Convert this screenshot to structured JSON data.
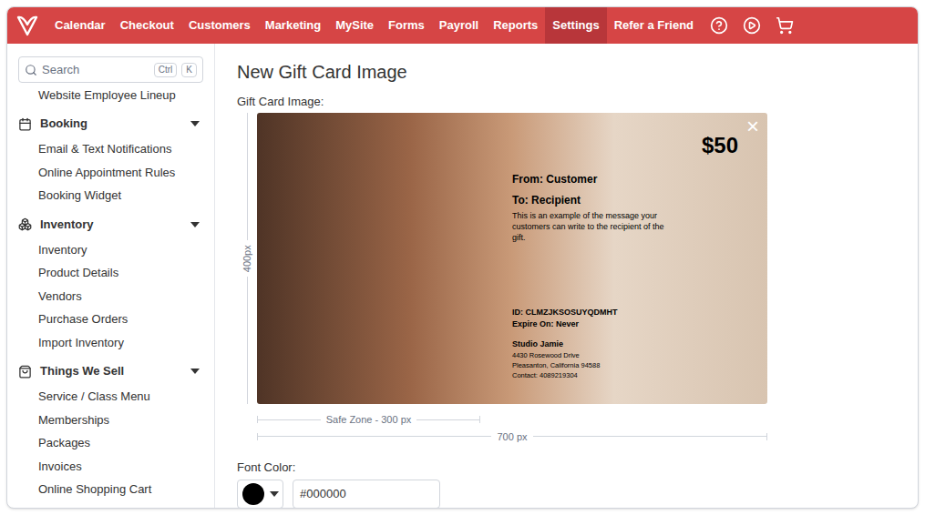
{
  "nav": {
    "items": [
      {
        "label": "Calendar",
        "selected": false
      },
      {
        "label": "Checkout",
        "selected": false
      },
      {
        "label": "Customers",
        "selected": false
      },
      {
        "label": "Marketing",
        "selected": false
      },
      {
        "label": "MySite",
        "selected": false
      },
      {
        "label": "Forms",
        "selected": false
      },
      {
        "label": "Payroll",
        "selected": false
      },
      {
        "label": "Reports",
        "selected": false
      },
      {
        "label": "Settings",
        "selected": true
      },
      {
        "label": "Refer a Friend",
        "selected": false
      }
    ]
  },
  "search": {
    "placeholder": "Search",
    "shortcut": [
      "Ctrl",
      "K"
    ]
  },
  "sidebar": {
    "items": [
      "Website Employee Lineup"
    ],
    "sections": [
      {
        "title": "Booking",
        "icon": "calendar",
        "expanded": true,
        "items": [
          "Email & Text Notifications",
          "Online Appointment Rules",
          "Booking Widget"
        ]
      },
      {
        "title": "Inventory",
        "icon": "boxes",
        "expanded": true,
        "items": [
          "Inventory",
          "Product Details",
          "Vendors",
          "Purchase Orders",
          "Import Inventory"
        ]
      },
      {
        "title": "Things We Sell",
        "icon": "bag",
        "expanded": true,
        "items": [
          "Service / Class Menu",
          "Memberships",
          "Packages",
          "Invoices",
          "Online Shopping Cart"
        ]
      }
    ]
  },
  "page": {
    "title": "New Gift Card Image",
    "image_label": "Gift Card Image:",
    "height_label": "400px",
    "safe_zone_label": "Safe Zone - 300 px",
    "width_label": "700 px"
  },
  "card": {
    "amount": "$50",
    "close": "×",
    "from": "From: Customer",
    "to": "To: Recipient",
    "message": "This is an example of the message your customers can write to the recipient of the gift.",
    "id": "ID: CLMZJKSOSUYQDMHT",
    "expire": "Expire On: Never",
    "business": "Studio Jamie",
    "address_lines": [
      "4430 Rosewood Drive",
      "Pleasanton, California 94588",
      "Contact: 4089219304"
    ]
  },
  "font_color": {
    "label": "Font Color:",
    "value": "#000000"
  }
}
